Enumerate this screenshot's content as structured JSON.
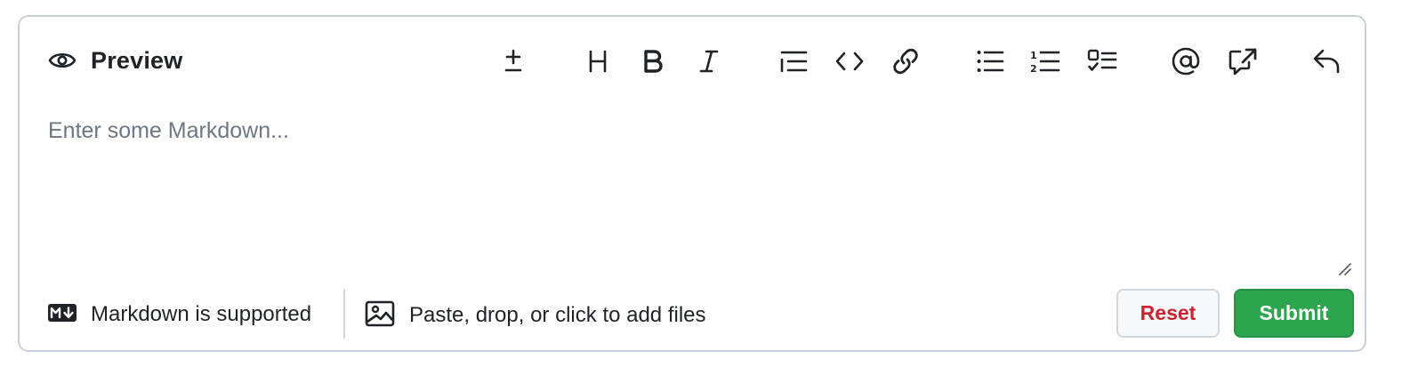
{
  "toolbar": {
    "preview_label": "Preview",
    "icons": {
      "preview": "eye-icon",
      "diff": "plus-minus-icon",
      "heading": "heading-icon",
      "bold": "bold-icon",
      "italic": "italic-icon",
      "quote": "quote-icon",
      "code": "code-icon",
      "link": "link-icon",
      "unordered_list": "unordered-list-icon",
      "ordered_list": "ordered-list-icon",
      "task_list": "tasklist-icon",
      "mention": "mention-icon",
      "reference": "cross-reference-icon",
      "reply": "reply-icon"
    }
  },
  "editor": {
    "placeholder": "Enter some Markdown...",
    "value": ""
  },
  "footer": {
    "markdown_note": "Markdown is supported",
    "markdown_icon": "markdown-icon",
    "attach_note": "Paste, drop, or click to add files",
    "attach_icon": "image-icon",
    "reset_label": "Reset",
    "submit_label": "Submit"
  },
  "colors": {
    "border": "#c7d0db",
    "text": "#1f2328",
    "placeholder": "#6e7781",
    "reset_text": "#cf222e",
    "submit_bg": "#2da44e"
  }
}
